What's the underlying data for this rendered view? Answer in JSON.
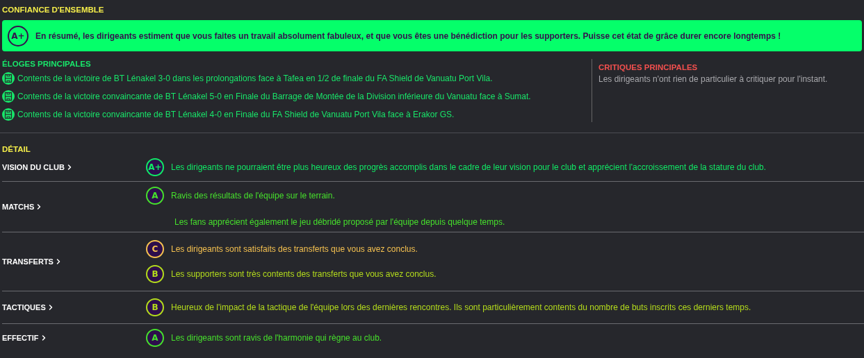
{
  "overall": {
    "heading": "CONFIANCE D'ENSEMBLE",
    "grade": "A+",
    "summary": "En résumé, les dirigeants estiment que vous faites un travail absolument fabuleux, et que vous êtes une bénédiction pour les supporters. Puisse cet état de grâce durer encore longtemps !"
  },
  "praise": {
    "heading": "ÉLOGES PRINCIPALES",
    "items": [
      "Contents de la victoire de BT Lénakel 3-0 dans les prolongations face à Tafea en 1/2 de finale du FA Shield de Vanuatu Port Vila.",
      "Contents de la victoire convaincante de BT Lénakel 5-0 en Finale du Barrage de Montée de la Division inférieure du Vanuatu face à Sumat.",
      "Contents de la victoire convaincante de BT Lénakel 4-0 en Finale du FA Shield de Vanuatu Port Vila face à Erakor GS."
    ]
  },
  "criticism": {
    "heading": "CRITIQUES PRINCIPALES",
    "text": "Les dirigeants n'ont rien de particulier à critiquer pour l'instant."
  },
  "detail": {
    "heading": "DÉTAIL",
    "sections": [
      {
        "label": "VISION DU CLUB",
        "comments": [
          {
            "grade": "A+",
            "color": "#10ea66",
            "text": "Les dirigeants ne pourraient être plus heureux des progrès accomplis dans le cadre de leur vision pour le club et apprécient l'accroissement de la stature du club."
          }
        ]
      },
      {
        "label": "MATCHS",
        "comments": [
          {
            "grade": "A",
            "color": "#46e02c",
            "text": "Ravis des résultats de l'équipe sur le terrain."
          },
          {
            "color": "#46e02c",
            "text": "Les fans apprécient également le jeu débridé proposé par l'équipe depuis quelque temps."
          }
        ]
      },
      {
        "label": "TRANSFERTS",
        "comments": [
          {
            "grade": "C",
            "color": "#f5c150",
            "text": "Les dirigeants sont satisfaits des transferts que vous avez conclus."
          },
          {
            "grade": "B",
            "color": "#b4dc1c",
            "text": "Les supporters sont très contents des transferts que vous avez conclus."
          }
        ]
      },
      {
        "label": "TACTIQUES",
        "comments": [
          {
            "grade": "B",
            "color": "#b4dc1c",
            "text": "Heureux de l'impact de la tactique de l'équipe lors des dernières rencontres. Ils sont particulièrement contents du nombre de buts inscrits ces derniers temps."
          }
        ]
      },
      {
        "label": "EFFECTIF",
        "comments": [
          {
            "grade": "A",
            "color": "#46e02c",
            "text": "Les dirigeants sont ravis de l'harmonie qui règne au club."
          }
        ]
      }
    ]
  }
}
